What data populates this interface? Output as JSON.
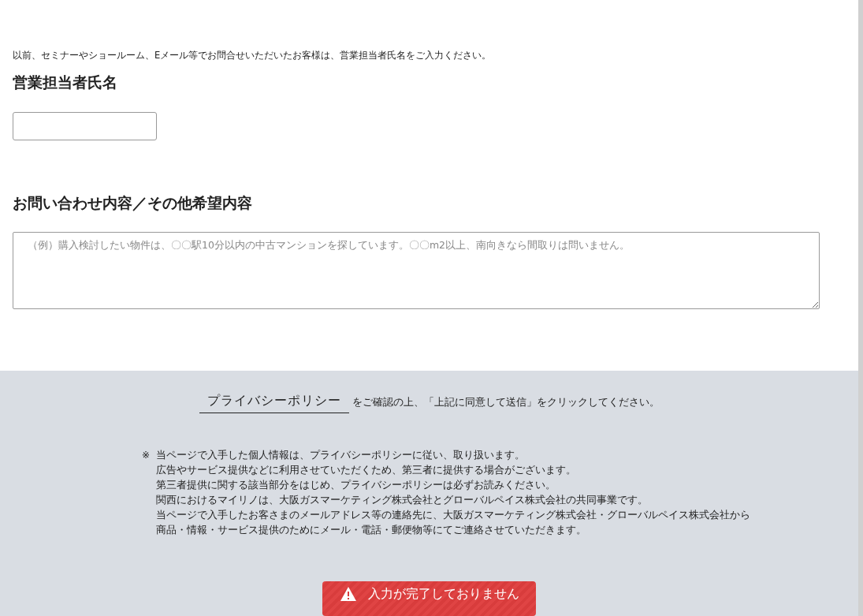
{
  "intro": "以前、セミナーやショールーム、Eメール等でお問合せいただいたお客様は、営業担当者氏名をご入力ください。",
  "sales_rep": {
    "label": "営業担当者氏名"
  },
  "inquiry": {
    "label": "お問い合わせ内容／その他希望内容",
    "placeholder": "（例）購入検討したい物件は、〇〇駅10分以内の中古マンションを探しています。〇〇m2以上、南向きなら間取りは問いません。"
  },
  "consent": {
    "link": "プライバシーポリシー",
    "text": "をご確認の上、「上記に同意して送信」をクリックしてください。"
  },
  "notes": {
    "mark": "※",
    "lines": [
      "当ページで入手した個人情報は、プライバシーポリシーに従い、取り扱います。",
      "広告やサービス提供などに利用させていただくため、第三者に提供する場合がございます。",
      "第三者提供に関する該当部分をはじめ、プライバシーポリシーは必ずお読みください。",
      "関西におけるマイリノは、大阪ガスマーケティング株式会社とグローバルペイス株式会社の共同事業です。",
      "当ページで入手したお客さまのメールアドレス等の連絡先に、大阪ガスマーケティング株式会社・グローバルペイス株式会社から",
      "商品・情報・サービス提供のためにメール・電話・郵便物等にてご連絡させていただきます。"
    ]
  },
  "submit": {
    "label": "入力が完了しておりません",
    "disabled": true
  }
}
